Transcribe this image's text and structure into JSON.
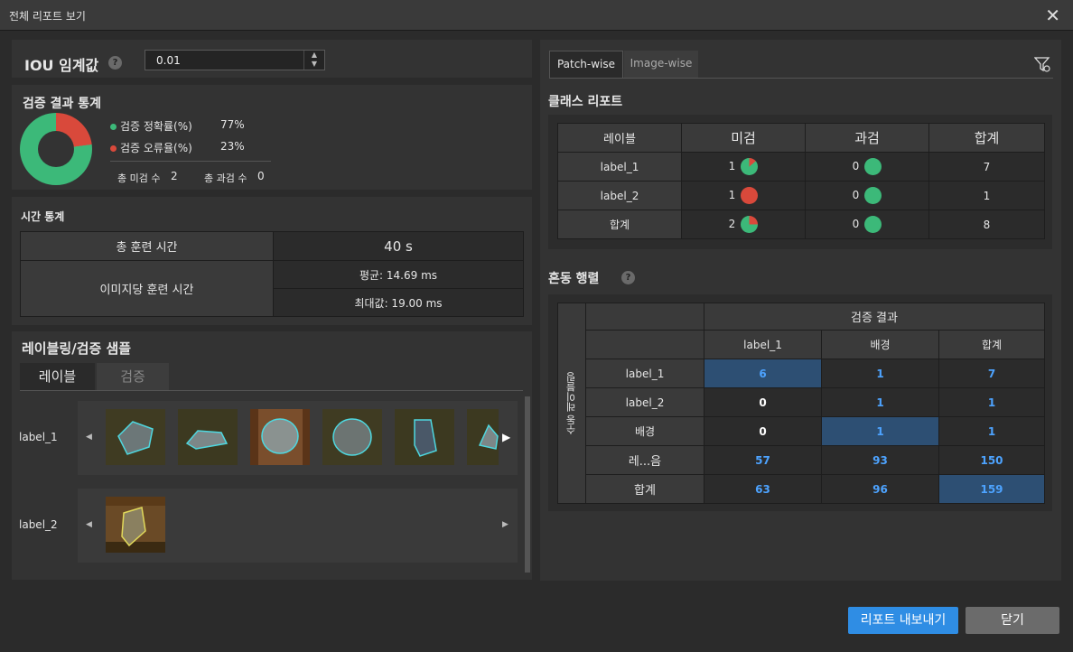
{
  "window": {
    "title": "전체 리포트 보기"
  },
  "iou": {
    "label": "IOU 임계값",
    "value": "0.01"
  },
  "verify_stats": {
    "title": "검증 결과 통계",
    "accuracy_label": "검증 정확률(%)",
    "accuracy_value": "77%",
    "error_label": "검증 오류율(%)",
    "error_value": "23%",
    "missed_label": "총 미검 수",
    "missed_value": "2",
    "over_label": "총 과검 수",
    "over_value": "0",
    "accuracy_percent": 77,
    "colors": {
      "accuracy": "#3cb979",
      "error": "#d9493b"
    }
  },
  "time_stats": {
    "title": "시간 통계",
    "total_label": "총 훈련 시간",
    "total_value": "40 s",
    "per_image_label": "이미지당 훈련 시간",
    "avg": "평균: 14.69 ms",
    "max": "최대값: 19.00 ms"
  },
  "samples": {
    "title": "레이블링/검증 샘플",
    "tabs": [
      "레이블",
      "검증"
    ],
    "rows": [
      {
        "label": "label_1"
      },
      {
        "label": "label_2"
      }
    ]
  },
  "right_tabs": [
    "Patch-wise",
    "Image-wise"
  ],
  "class_report": {
    "title": "클래스 리포트",
    "headers": [
      "레이블",
      "미검",
      "과검",
      "합계"
    ],
    "rows": [
      {
        "label": "label_1",
        "missed": "1",
        "over": "0",
        "total": "7"
      },
      {
        "label": "label_2",
        "missed": "1",
        "over": "0",
        "total": "1"
      },
      {
        "label": "합계",
        "missed": "2",
        "over": "0",
        "total": "8"
      }
    ]
  },
  "confusion": {
    "title": "혼동 행렬",
    "col_group": "검증 결과",
    "row_group": "수동 레이블링",
    "col_headers": [
      "label_1",
      "배경",
      "합계"
    ],
    "rows": [
      {
        "label": "label_1",
        "values": [
          "6",
          "1",
          "7"
        ]
      },
      {
        "label": "label_2",
        "values": [
          "0",
          "1",
          "1"
        ]
      },
      {
        "label": "배경",
        "values": [
          "0",
          "1",
          "1"
        ]
      },
      {
        "label": "레...음",
        "values": [
          "57",
          "93",
          "150"
        ]
      },
      {
        "label": "합계",
        "values": [
          "63",
          "96",
          "159"
        ]
      }
    ]
  },
  "buttons": {
    "export": "리포트 내보내기",
    "close": "닫기"
  }
}
